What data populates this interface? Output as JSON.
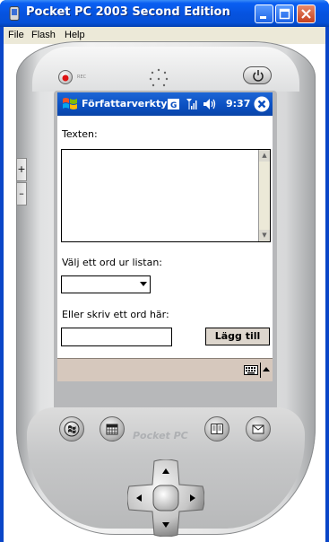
{
  "window": {
    "title": "Pocket PC 2003 Second Edition"
  },
  "menu": {
    "items": [
      "File",
      "Flash",
      "Help"
    ]
  },
  "device": {
    "rec_label": "REC",
    "brand": "Pocket PC",
    "side_buttons": [
      "+",
      "–"
    ]
  },
  "navbar": {
    "title": "Författarverkty",
    "time": "9:37"
  },
  "form": {
    "text_label": "Texten:",
    "text_value": "",
    "select_label": "Välj ett ord ur listan:",
    "select_value": "",
    "entry_label": "Eller skriv ett ord här:",
    "entry_value": "",
    "add_button": "Lägg till"
  },
  "colors": {
    "titlebar": "#0550d6",
    "navbar": "#0b4fc0",
    "sipbar": "#d6c8bd",
    "menubar": "#ece9d8"
  },
  "icons": [
    "app-icon",
    "minimize-icon",
    "maximize-icon",
    "close-icon",
    "windows-flag-icon",
    "input-panel-icon",
    "signal-icon",
    "speaker-icon",
    "ok-close-icon",
    "keyboard-icon",
    "record-button-icon",
    "power-icon",
    "start-hw-icon",
    "calendar-hw-icon",
    "contacts-hw-icon",
    "inbox-hw-icon",
    "dpad-icon"
  ]
}
